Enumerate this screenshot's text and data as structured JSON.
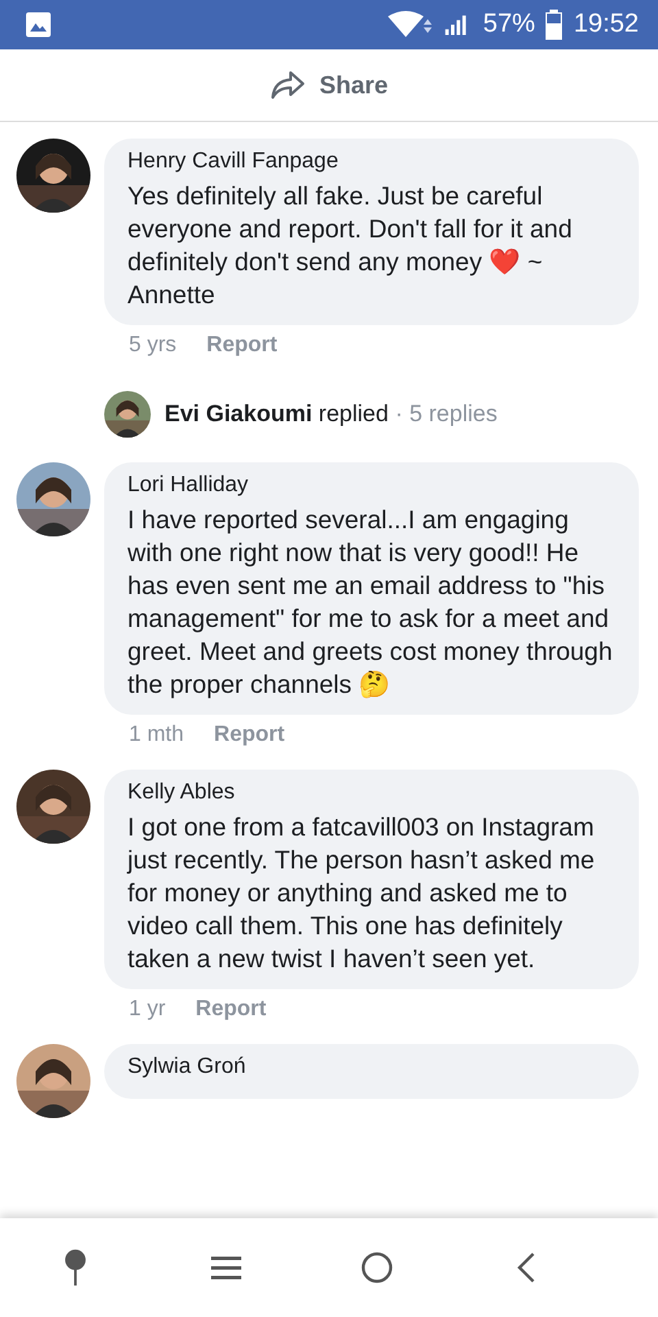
{
  "status_bar": {
    "battery": "57%",
    "time": "19:52"
  },
  "header": {
    "share_label": "Share"
  },
  "comments": [
    {
      "kind": "comment",
      "author": "Henry Cavill Fanpage",
      "text": "Yes definitely all fake. Just be careful everyone and report. Don't fall for it and definitely don't send any money ❤️ ~ Annette",
      "age": "5 yrs",
      "action": "Report"
    },
    {
      "kind": "replies",
      "author": "Evi Giakoumi",
      "verb": "replied",
      "count": "· 5 replies"
    },
    {
      "kind": "comment",
      "author": "Lori Halliday",
      "text": "I have reported several...I am engaging with one right now that is very good!! He has even sent me an email address to \"his management\" for me to ask for a meet and greet. Meet and greets cost money through the proper channels 🤔",
      "age": "1 mth",
      "action": "Report"
    },
    {
      "kind": "comment",
      "author": "Kelly Ables",
      "text": "I got one from a fatcavill003 on Instagram just recently. The person hasn’t asked me for money or anything and asked me to video call them. This one has definitely taken a new twist I haven’t seen yet.",
      "age": "1 yr",
      "action": "Report"
    },
    {
      "kind": "partial",
      "author": "Sylwia Groń"
    }
  ]
}
